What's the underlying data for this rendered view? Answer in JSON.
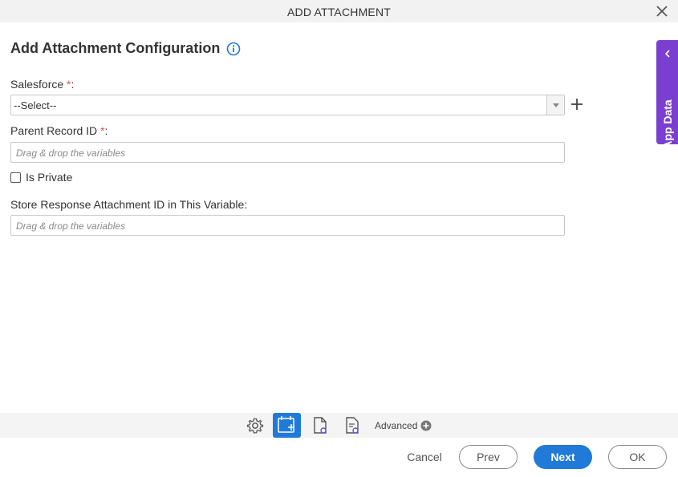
{
  "dialog": {
    "title": "ADD ATTACHMENT"
  },
  "form": {
    "heading": "Add Attachment Configuration",
    "salesforce": {
      "label": "Salesforce",
      "required_mark": "*",
      "colon": ":",
      "selected": "--Select--"
    },
    "parent_record": {
      "label": "Parent Record ID",
      "required_mark": "*",
      "colon": ":",
      "placeholder": "Drag & drop the variables"
    },
    "is_private": {
      "label": "Is Private",
      "checked": false
    },
    "store_response": {
      "label": "Store Response Attachment ID in This Variable:",
      "placeholder": "Drag & drop the variables"
    }
  },
  "side_panel": {
    "label": "App Data"
  },
  "toolbar": {
    "advanced_label": "Advanced",
    "icons": [
      "gear-icon",
      "configuration-icon",
      "page-settings-icon",
      "document-settings-icon"
    ]
  },
  "footer": {
    "cancel": "Cancel",
    "prev": "Prev",
    "next": "Next",
    "ok": "OK"
  },
  "colors": {
    "accent": "#1f7ad8",
    "side_panel": "#7a3fd1",
    "required": "#d9534f"
  }
}
